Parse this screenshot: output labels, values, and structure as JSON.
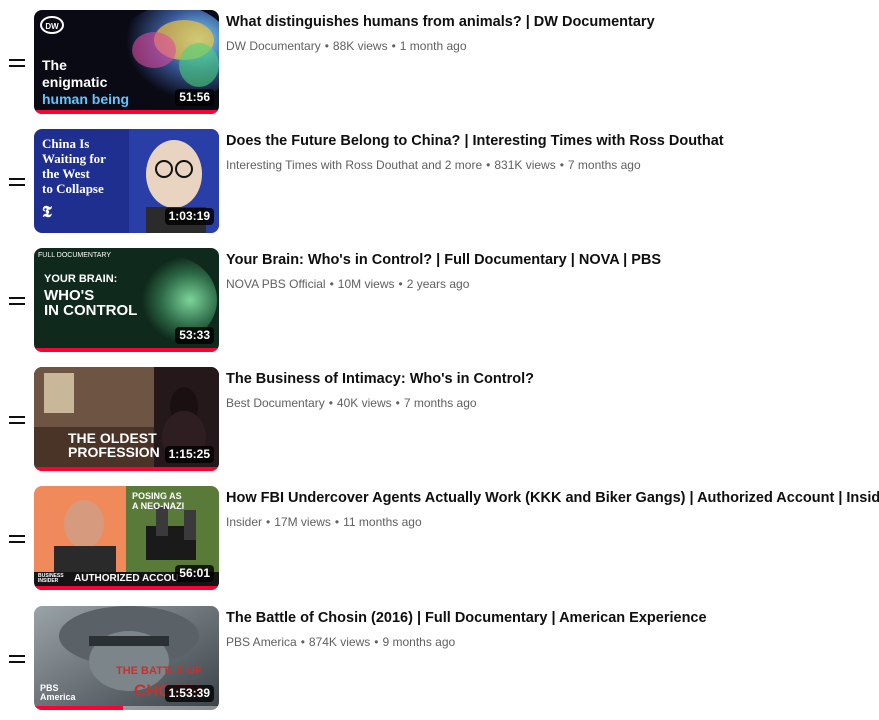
{
  "playlist": {
    "items": [
      {
        "title": "What distinguishes humans from animals? | DW Documentary",
        "channel": "DW Documentary",
        "extra": "",
        "views": "88K views",
        "age": "1 month ago",
        "duration": "51:56",
        "progress": 1.0,
        "thumb_text": [
          "The",
          "enigmatic",
          "human being"
        ],
        "badge": "DW"
      },
      {
        "title": "Does the Future Belong to China? | Interesting Times with Ross Douthat",
        "channel": "Interesting Times with Ross Douthat",
        "extra": "and 2 more",
        "views": "831K views",
        "age": "7 months ago",
        "duration": "1:03:19",
        "progress": 0.0,
        "thumb_text": [
          "China Is",
          "Waiting for",
          "the West",
          "to Collapse"
        ],
        "badge": ""
      },
      {
        "title": "Your Brain: Who's in Control? | Full Documentary | NOVA | PBS",
        "channel": "NOVA PBS Official",
        "extra": "",
        "views": "10M views",
        "age": "2 years ago",
        "duration": "53:33",
        "progress": 1.0,
        "thumb_text": [
          "YOUR BRAIN:",
          "WHO'S",
          "IN CONTROL"
        ],
        "badge": "FULL DOCUMENTARY"
      },
      {
        "title": "The Business of Intimacy: Who's in Control?",
        "channel": "Best Documentary",
        "extra": "",
        "views": "40K views",
        "age": "7 months ago",
        "duration": "1:15:25",
        "progress": 1.0,
        "thumb_text": [
          "THE OLDEST",
          "PROFESSION"
        ],
        "badge": ""
      },
      {
        "title": "How FBI Undercover Agents Actually Work (KKK and Biker Gangs) | Authorized Account | Insider",
        "channel": "Insider",
        "extra": "",
        "views": "17M views",
        "age": "11 months ago",
        "duration": "56:01",
        "progress": 1.0,
        "thumb_text": [
          "POSING AS",
          "A NEO-NAZI",
          "AUTHORIZED ACCOU"
        ],
        "badge": "BUSINESS INSIDER"
      },
      {
        "title": "The Battle of Chosin (2016) | Full Documentary | American Experience",
        "channel": "PBS America",
        "extra": "",
        "views": "874K views",
        "age": "9 months ago",
        "duration": "1:53:39",
        "progress": 0.48,
        "thumb_text": [
          "THE BATTLE OF",
          "CHOSIN"
        ],
        "badge": "PBS America"
      }
    ]
  },
  "colors": {
    "progress": "#ff0033",
    "meta_text": "#606060",
    "title_text": "#0f0f0f"
  }
}
